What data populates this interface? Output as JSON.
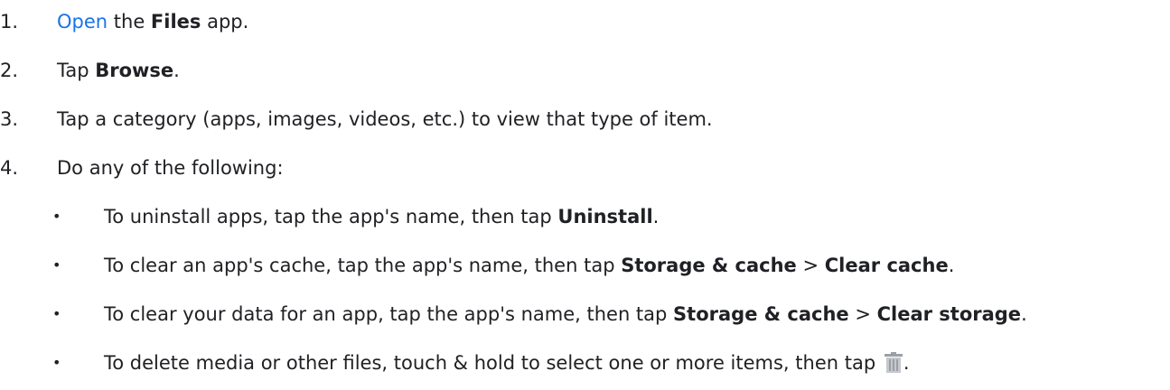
{
  "steps": [
    {
      "number": "1.",
      "link": "Open",
      "t1": " the ",
      "b1": "Files",
      "t2": " app."
    },
    {
      "number": "2.",
      "t1": "Tap ",
      "b1": "Browse",
      "t2": "."
    },
    {
      "number": "3.",
      "t1": "Tap a category (apps, images, videos, etc.) to view that type of item."
    },
    {
      "number": "4.",
      "t1": "Do any of the following:"
    }
  ],
  "bullet_char": "•",
  "sub_steps": [
    {
      "t1": "To uninstall apps, tap the app's name, then tap ",
      "b1": "Uninstall",
      "t2": "."
    },
    {
      "t1": "To clear an app's cache, tap the app's name, then tap ",
      "b1": "Storage & cache",
      "t2": " > ",
      "b2": "Clear cache",
      "t3": "."
    },
    {
      "t1": "To clear your data for an app, tap the app's name, then tap ",
      "b1": "Storage & cache",
      "t2": " > ",
      "b2": "Clear storage",
      "t3": "."
    },
    {
      "t1": "To delete media or other files, touch & hold to select one or more items, then tap ",
      "icon": "trash-icon",
      "t2": "."
    }
  ],
  "colors": {
    "text": "#202124",
    "link": "#1a73e8",
    "icon": "#9aa0a6"
  }
}
